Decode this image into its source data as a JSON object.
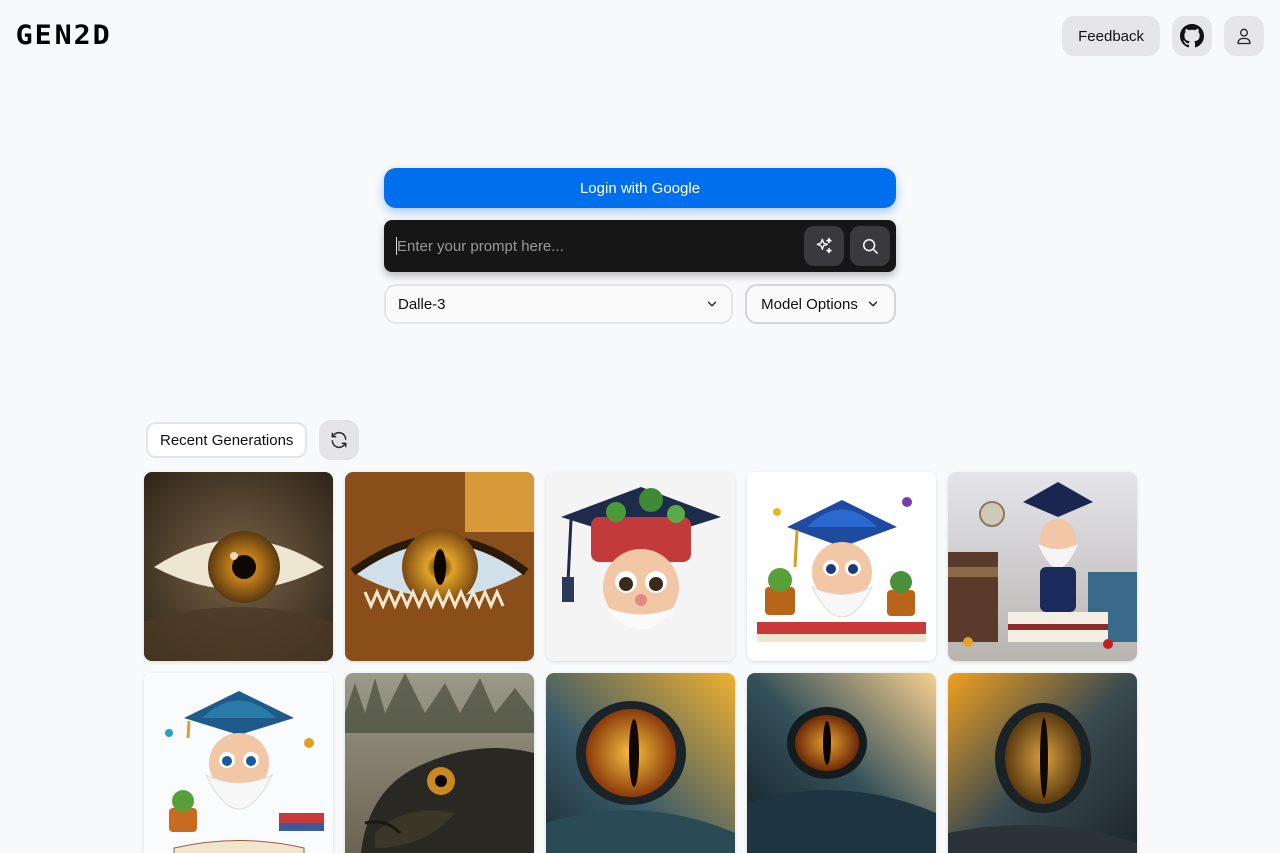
{
  "header": {
    "logo_letters": [
      "G",
      "E",
      "N",
      "2",
      "D"
    ],
    "feedback_label": "Feedback",
    "github_icon": "github-icon",
    "user_icon": "user-icon"
  },
  "auth": {
    "login_label": "Login with Google"
  },
  "prompt": {
    "placeholder": "Enter your prompt here...",
    "enhance_icon": "sparkles-icon",
    "search_icon": "search-icon"
  },
  "model": {
    "selected": "Dalle-3",
    "options_label": "Model Options"
  },
  "recent": {
    "label": "Recent Generations",
    "refresh_icon": "refresh-icon",
    "images": [
      {
        "subject": "dragon eye",
        "theme": "realistic-brown"
      },
      {
        "subject": "dragon eye",
        "theme": "mosaic"
      },
      {
        "subject": "gnome with graduation cap",
        "theme": "cartoon-jeweled"
      },
      {
        "subject": "gnome with graduation cap",
        "theme": "cartoon-blue"
      },
      {
        "subject": "gnome figurine on books",
        "theme": "figurine"
      },
      {
        "subject": "gnome with graduation cap",
        "theme": "cartoon-books"
      },
      {
        "subject": "dinosaur head",
        "theme": "photo-dark"
      },
      {
        "subject": "reptile eye",
        "theme": "sunset-blue"
      },
      {
        "subject": "reptile eye",
        "theme": "sunset-dark"
      },
      {
        "subject": "reptile eye",
        "theme": "sunset-orange"
      }
    ]
  },
  "colors": {
    "accent": "#006fee",
    "background": "#f8f9fa",
    "prompt_bar": "#161616"
  }
}
